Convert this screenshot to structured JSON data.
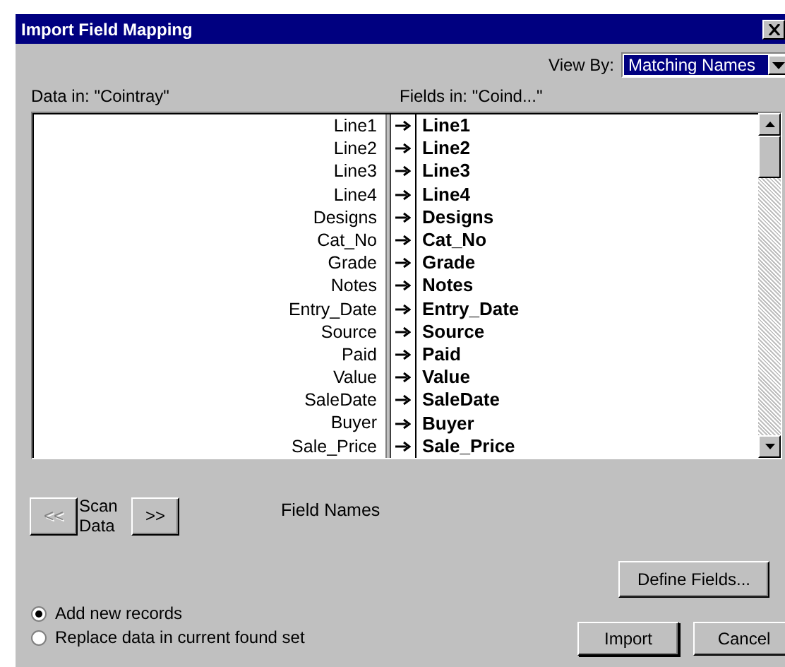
{
  "window": {
    "title": "Import Field Mapping"
  },
  "view_by": {
    "label": "View By:",
    "value": "Matching Names"
  },
  "source_label": "Data in: \"Cointray\"",
  "target_label": "Fields in: \"Coind...\"",
  "mappings": [
    {
      "source": "Line1",
      "target": "Line1"
    },
    {
      "source": "Line2",
      "target": "Line2"
    },
    {
      "source": "Line3",
      "target": "Line3"
    },
    {
      "source": "Line4",
      "target": "Line4"
    },
    {
      "source": "Designs",
      "target": "Designs"
    },
    {
      "source": "Cat_No",
      "target": "Cat_No"
    },
    {
      "source": "Grade",
      "target": "Grade"
    },
    {
      "source": "Notes",
      "target": "Notes"
    },
    {
      "source": "Entry_Date",
      "target": "Entry_Date"
    },
    {
      "source": "Source",
      "target": "Source"
    },
    {
      "source": "Paid",
      "target": "Paid"
    },
    {
      "source": "Value",
      "target": "Value"
    },
    {
      "source": "SaleDate",
      "target": "SaleDate"
    },
    {
      "source": "Buyer",
      "target": "Buyer"
    },
    {
      "source": "Sale_Price",
      "target": "Sale_Price"
    }
  ],
  "scan": {
    "prev": {
      "label": "<<",
      "disabled": true
    },
    "label": "Scan Data",
    "next": {
      "label": ">>",
      "disabled": false
    }
  },
  "scan_status": "Field Names",
  "define_button": "Define Fields...",
  "import_options": [
    {
      "label": "Add new records",
      "selected": true
    },
    {
      "label": "Replace data in current found set",
      "selected": false
    }
  ],
  "buttons": [
    "Import",
    "Cancel"
  ]
}
